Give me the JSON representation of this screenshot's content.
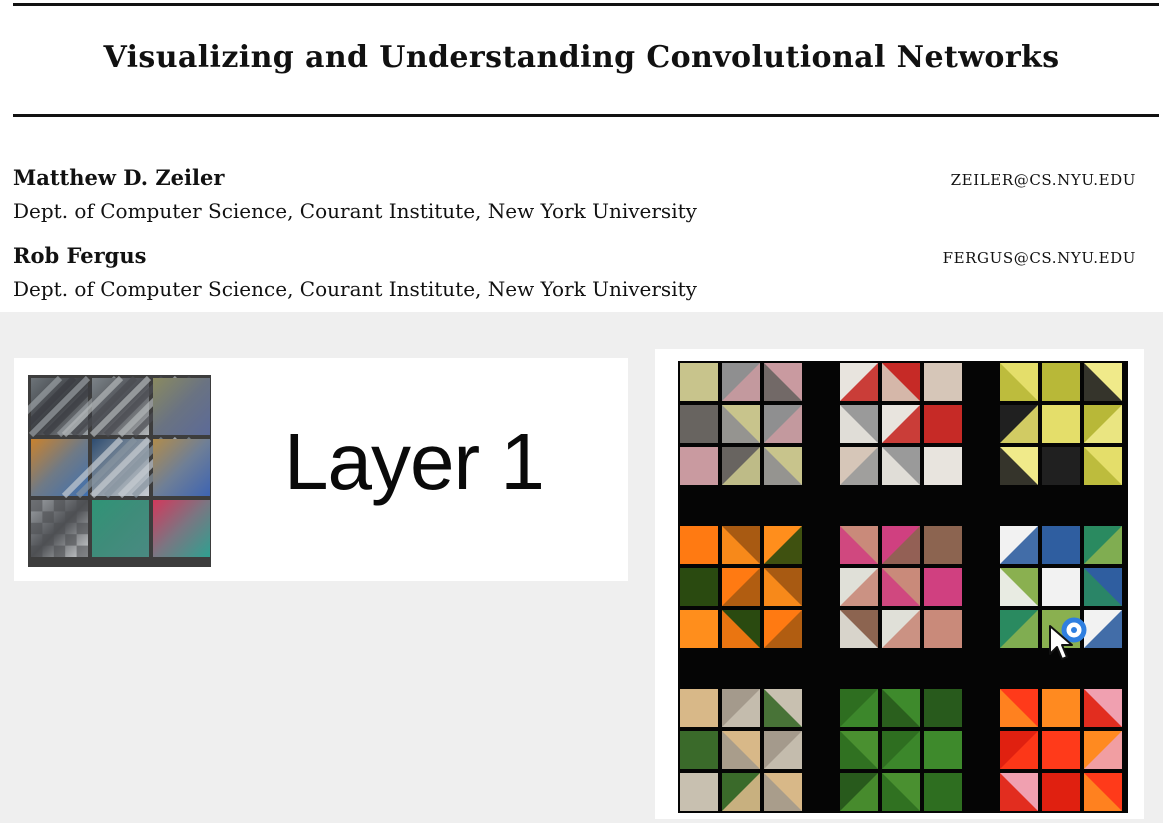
{
  "paper": {
    "title": "Visualizing and Understanding Convolutional Networks",
    "authors": [
      {
        "name": "Matthew D. Zeiler",
        "affiliation": "Dept. of Computer Science, Courant Institute, New York University",
        "email": "ZEILER@CS.NYU.EDU"
      },
      {
        "name": "Rob Fergus",
        "affiliation": "Dept. of Computer Science, Courant Institute, New York University",
        "email": "FERGUS@CS.NYU.EDU"
      }
    ]
  },
  "figure": {
    "layer_label": "Layer 1",
    "filters": [
      {
        "name": "diagonal-stripes-dark",
        "colors": [
          "#6d7479",
          "#3b3d42",
          "#9aa0a4"
        ]
      },
      {
        "name": "diagonal-stripes-grey",
        "colors": [
          "#7c8388",
          "#4a4c52",
          "#b4b8ba"
        ]
      },
      {
        "name": "olive-blue-gradient",
        "colors": [
          "#8a8a60",
          "#6a7382",
          "#5c6a98"
        ]
      },
      {
        "name": "orange-blue-gradient",
        "colors": [
          "#c9822e",
          "#6f7a86",
          "#3f70b0"
        ]
      },
      {
        "name": "dark-diagonal-blob",
        "colors": [
          "#2e4c70",
          "#8894a0",
          "#c6ccd2"
        ]
      },
      {
        "name": "tan-blue-gradient",
        "colors": [
          "#b08c4c",
          "#6f7f96",
          "#3e64b2"
        ]
      },
      {
        "name": "checker-grey",
        "colors": [
          "#9ea2a6",
          "#4e5054",
          "#cfd2d4"
        ]
      },
      {
        "name": "teal-green",
        "colors": [
          "#2f9476",
          "#3f8c7a",
          "#4a8a82"
        ]
      },
      {
        "name": "pink-teal-gradient",
        "colors": [
          "#d2395c",
          "#7a7682",
          "#2fa090"
        ]
      }
    ],
    "patch_groups": [
      {
        "name": "diagonal-edges-grey-yellow",
        "colors": [
          "#c8c48c",
          "#8f8f90",
          "#c99aa0",
          "#686460"
        ]
      },
      {
        "name": "red-white-edges",
        "colors": [
          "#e8e4de",
          "#c62a26",
          "#d6c6b8",
          "#9a9a9a"
        ]
      },
      {
        "name": "yellow-green-edges",
        "colors": [
          "#e4de6a",
          "#b8b838",
          "#f0ea8a",
          "#202020"
        ]
      },
      {
        "name": "orange-brown",
        "colors": [
          "#ff7a12",
          "#a85a12",
          "#ff8e1c",
          "#2a4a10"
        ]
      },
      {
        "name": "pink-brown-diagonals",
        "colors": [
          "#c98a7a",
          "#d04080",
          "#8c6450",
          "#e0e0d8"
        ]
      },
      {
        "name": "blue-white-green",
        "colors": [
          "#f2f2f2",
          "#2f5ea0",
          "#2a8a60",
          "#8ab050"
        ]
      },
      {
        "name": "beige-checker",
        "colors": [
          "#d8b888",
          "#a49a8c",
          "#c8c0b0",
          "#3a6a2a"
        ]
      },
      {
        "name": "green-texture",
        "colors": [
          "#2e6e20",
          "#3e8a2c",
          "#285a1c",
          "#4a9030"
        ]
      },
      {
        "name": "red-orange-pink",
        "colors": [
          "#ff3a1a",
          "#ff8a20",
          "#f0a0b0",
          "#e02010"
        ]
      }
    ]
  }
}
